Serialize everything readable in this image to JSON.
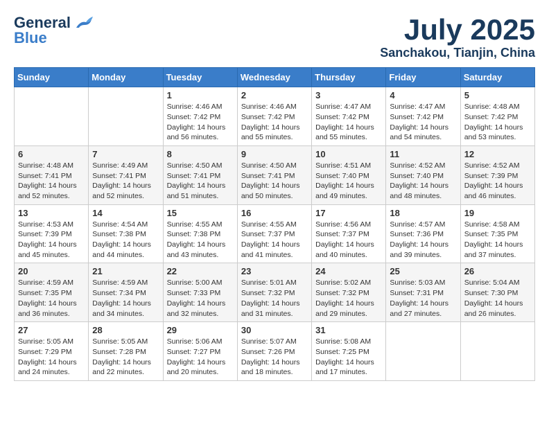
{
  "logo": {
    "line1": "General",
    "line2": "Blue"
  },
  "title": {
    "month": "July 2025",
    "location": "Sanchakou, Tianjin, China"
  },
  "headers": [
    "Sunday",
    "Monday",
    "Tuesday",
    "Wednesday",
    "Thursday",
    "Friday",
    "Saturday"
  ],
  "weeks": [
    [
      {
        "day": "",
        "info": ""
      },
      {
        "day": "",
        "info": ""
      },
      {
        "day": "1",
        "info": "Sunrise: 4:46 AM\nSunset: 7:42 PM\nDaylight: 14 hours\nand 56 minutes."
      },
      {
        "day": "2",
        "info": "Sunrise: 4:46 AM\nSunset: 7:42 PM\nDaylight: 14 hours\nand 55 minutes."
      },
      {
        "day": "3",
        "info": "Sunrise: 4:47 AM\nSunset: 7:42 PM\nDaylight: 14 hours\nand 55 minutes."
      },
      {
        "day": "4",
        "info": "Sunrise: 4:47 AM\nSunset: 7:42 PM\nDaylight: 14 hours\nand 54 minutes."
      },
      {
        "day": "5",
        "info": "Sunrise: 4:48 AM\nSunset: 7:42 PM\nDaylight: 14 hours\nand 53 minutes."
      }
    ],
    [
      {
        "day": "6",
        "info": "Sunrise: 4:48 AM\nSunset: 7:41 PM\nDaylight: 14 hours\nand 52 minutes."
      },
      {
        "day": "7",
        "info": "Sunrise: 4:49 AM\nSunset: 7:41 PM\nDaylight: 14 hours\nand 52 minutes."
      },
      {
        "day": "8",
        "info": "Sunrise: 4:50 AM\nSunset: 7:41 PM\nDaylight: 14 hours\nand 51 minutes."
      },
      {
        "day": "9",
        "info": "Sunrise: 4:50 AM\nSunset: 7:41 PM\nDaylight: 14 hours\nand 50 minutes."
      },
      {
        "day": "10",
        "info": "Sunrise: 4:51 AM\nSunset: 7:40 PM\nDaylight: 14 hours\nand 49 minutes."
      },
      {
        "day": "11",
        "info": "Sunrise: 4:52 AM\nSunset: 7:40 PM\nDaylight: 14 hours\nand 48 minutes."
      },
      {
        "day": "12",
        "info": "Sunrise: 4:52 AM\nSunset: 7:39 PM\nDaylight: 14 hours\nand 46 minutes."
      }
    ],
    [
      {
        "day": "13",
        "info": "Sunrise: 4:53 AM\nSunset: 7:39 PM\nDaylight: 14 hours\nand 45 minutes."
      },
      {
        "day": "14",
        "info": "Sunrise: 4:54 AM\nSunset: 7:38 PM\nDaylight: 14 hours\nand 44 minutes."
      },
      {
        "day": "15",
        "info": "Sunrise: 4:55 AM\nSunset: 7:38 PM\nDaylight: 14 hours\nand 43 minutes."
      },
      {
        "day": "16",
        "info": "Sunrise: 4:55 AM\nSunset: 7:37 PM\nDaylight: 14 hours\nand 41 minutes."
      },
      {
        "day": "17",
        "info": "Sunrise: 4:56 AM\nSunset: 7:37 PM\nDaylight: 14 hours\nand 40 minutes."
      },
      {
        "day": "18",
        "info": "Sunrise: 4:57 AM\nSunset: 7:36 PM\nDaylight: 14 hours\nand 39 minutes."
      },
      {
        "day": "19",
        "info": "Sunrise: 4:58 AM\nSunset: 7:35 PM\nDaylight: 14 hours\nand 37 minutes."
      }
    ],
    [
      {
        "day": "20",
        "info": "Sunrise: 4:59 AM\nSunset: 7:35 PM\nDaylight: 14 hours\nand 36 minutes."
      },
      {
        "day": "21",
        "info": "Sunrise: 4:59 AM\nSunset: 7:34 PM\nDaylight: 14 hours\nand 34 minutes."
      },
      {
        "day": "22",
        "info": "Sunrise: 5:00 AM\nSunset: 7:33 PM\nDaylight: 14 hours\nand 32 minutes."
      },
      {
        "day": "23",
        "info": "Sunrise: 5:01 AM\nSunset: 7:32 PM\nDaylight: 14 hours\nand 31 minutes."
      },
      {
        "day": "24",
        "info": "Sunrise: 5:02 AM\nSunset: 7:32 PM\nDaylight: 14 hours\nand 29 minutes."
      },
      {
        "day": "25",
        "info": "Sunrise: 5:03 AM\nSunset: 7:31 PM\nDaylight: 14 hours\nand 27 minutes."
      },
      {
        "day": "26",
        "info": "Sunrise: 5:04 AM\nSunset: 7:30 PM\nDaylight: 14 hours\nand 26 minutes."
      }
    ],
    [
      {
        "day": "27",
        "info": "Sunrise: 5:05 AM\nSunset: 7:29 PM\nDaylight: 14 hours\nand 24 minutes."
      },
      {
        "day": "28",
        "info": "Sunrise: 5:05 AM\nSunset: 7:28 PM\nDaylight: 14 hours\nand 22 minutes."
      },
      {
        "day": "29",
        "info": "Sunrise: 5:06 AM\nSunset: 7:27 PM\nDaylight: 14 hours\nand 20 minutes."
      },
      {
        "day": "30",
        "info": "Sunrise: 5:07 AM\nSunset: 7:26 PM\nDaylight: 14 hours\nand 18 minutes."
      },
      {
        "day": "31",
        "info": "Sunrise: 5:08 AM\nSunset: 7:25 PM\nDaylight: 14 hours\nand 17 minutes."
      },
      {
        "day": "",
        "info": ""
      },
      {
        "day": "",
        "info": ""
      }
    ]
  ]
}
